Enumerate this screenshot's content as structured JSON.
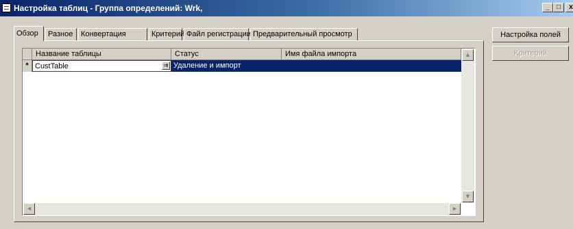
{
  "window": {
    "title": "Настройка таблиц - Группа определений: Wrk,",
    "min_glyph": "_",
    "max_glyph": "□",
    "close_glyph": "x"
  },
  "tabs": [
    {
      "label": "Обзор",
      "active": true
    },
    {
      "label": "Разное"
    },
    {
      "label": "Конвертация"
    },
    {
      "label": "Критерий"
    },
    {
      "label": "Файл регистрации"
    },
    {
      "label": "Предварительный просмотр"
    }
  ],
  "grid": {
    "columns": [
      "Название таблицы",
      "Статус",
      "Имя файла импорта"
    ],
    "rows": [
      {
        "marker": "*",
        "table": "CustTable",
        "status": "Удаление и импорт",
        "import_file": ""
      }
    ],
    "lookup_glyph": "⇉"
  },
  "buttons": {
    "field_setup": "Настройка полей",
    "criteria": "Критерий"
  },
  "scroll": {
    "up": "▲",
    "down": "▼",
    "left": "◄",
    "right": "►"
  }
}
